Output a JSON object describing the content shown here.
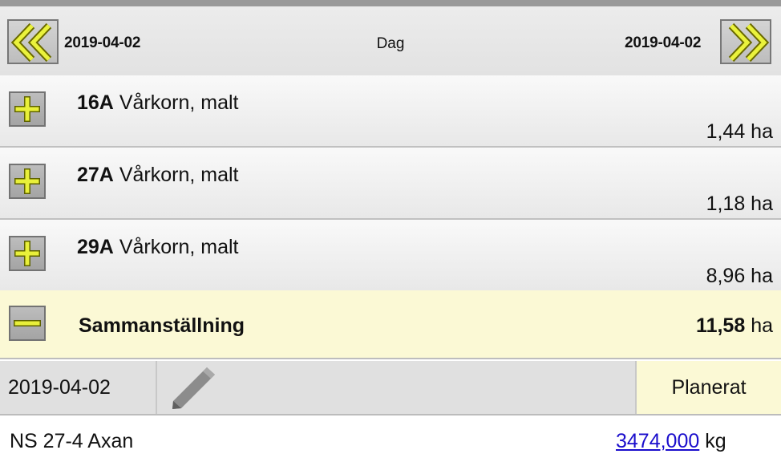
{
  "date_nav": {
    "from_date": "2019-04-02",
    "mode": "Dag",
    "to_date": "2019-04-02"
  },
  "fields": [
    {
      "id": "16A",
      "crop": "Vårkorn, malt",
      "area": "1,44 ha"
    },
    {
      "id": "27A",
      "crop": "Vårkorn, malt",
      "area": "1,18 ha"
    },
    {
      "id": "29A",
      "crop": "Vårkorn, malt",
      "area": "8,96 ha"
    }
  ],
  "summary": {
    "title": "Sammanställning",
    "total_value": "11,58",
    "total_unit": "ha"
  },
  "entry": {
    "date": "2019-04-02",
    "status": "Planerat"
  },
  "product": {
    "name": "NS 27-4 Axan",
    "amount": "3474,000",
    "unit": "kg"
  },
  "icons": {
    "prev": "double-chevron-left-icon",
    "next": "double-chevron-right-icon",
    "expand": "plus-icon",
    "collapse": "minus-icon",
    "edit": "pencil-icon"
  },
  "colors": {
    "accent_yellow": "#e9f03a",
    "summary_bg": "#fbf9d5",
    "link": "#1a0dcc"
  }
}
